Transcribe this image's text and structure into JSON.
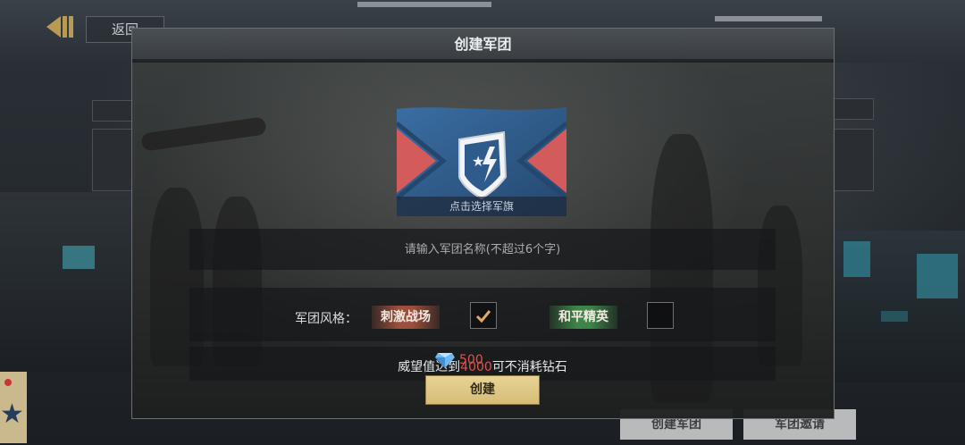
{
  "top": {
    "back_label": "返回"
  },
  "background": {
    "buttons": [
      "创建军团",
      "军团邀请"
    ]
  },
  "dialog": {
    "title": "创建军团",
    "flag_hint": "点击选择军旗",
    "name_placeholder": "请输入军团名称(不超过6个字)",
    "style_label": "军团风格：",
    "styles": [
      {
        "label": "刺激战场",
        "checked": true,
        "color": "#a8553f"
      },
      {
        "label": "和平精英",
        "checked": false,
        "color": "#3f8a4a"
      }
    ],
    "prestige": {
      "prefix": "威望值达到",
      "value": "4000",
      "suffix": "可不消耗钻石"
    },
    "cost": {
      "icon": "diamond-icon",
      "value": "500"
    },
    "create_label": "创建"
  },
  "colors": {
    "accent_gold": "#d9c07d",
    "cost_red": "#e2524c",
    "flag_blue": "#2e5b8c",
    "flag_red": "#d45b5b"
  }
}
